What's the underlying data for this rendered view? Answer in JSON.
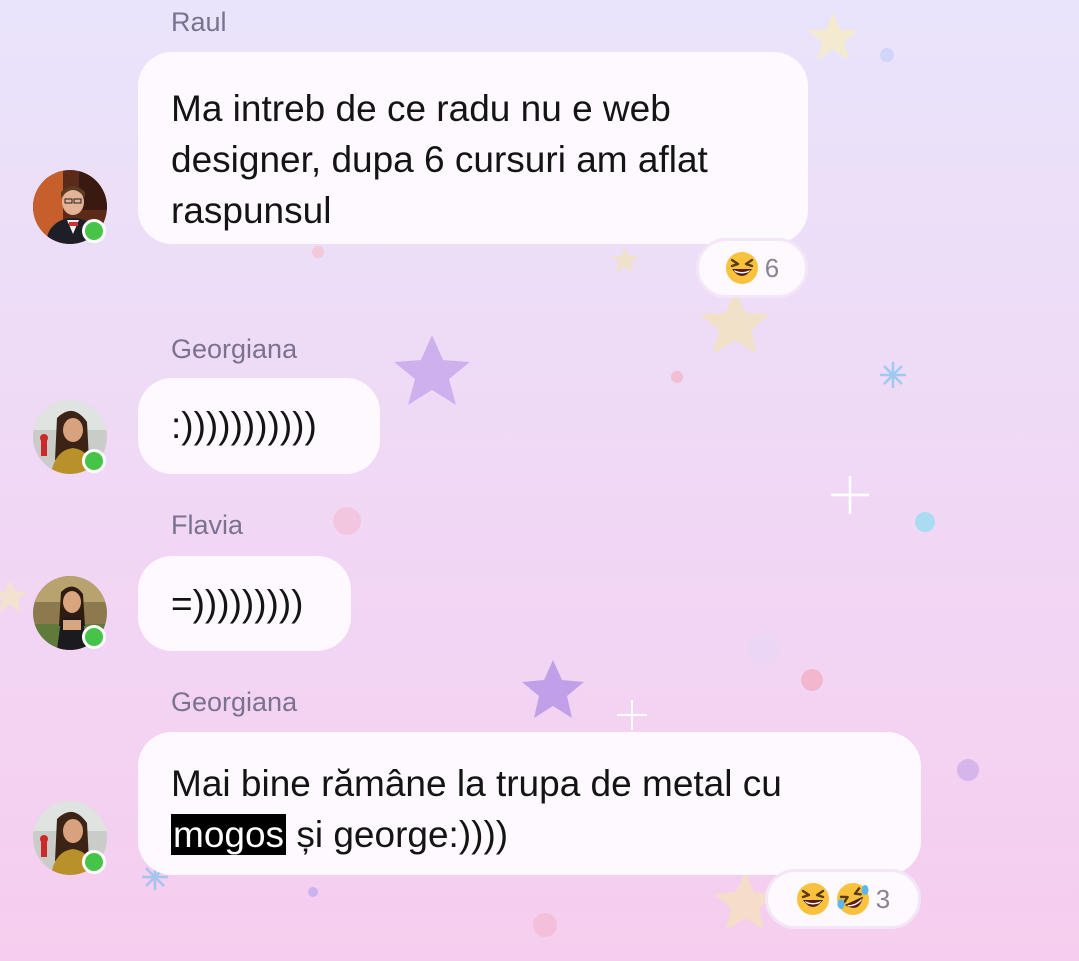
{
  "messages": [
    {
      "sender": "Raul",
      "lines": [
        "Ma intreb de ce radu nu e web",
        "designer, dupa 6 cursuri am aflat",
        "raspunsul"
      ],
      "reactions": {
        "emojis": [
          "grinning-squinting-face"
        ],
        "count": "6"
      }
    },
    {
      "sender": "Georgiana",
      "text": ":)))))))))))"
    },
    {
      "sender": "Flavia",
      "text": "=)))))))))"
    },
    {
      "sender": "Georgiana",
      "line1": "Mai bine rămâne la trupa de metal cu",
      "highlighted": "mogos",
      "line2_rest": " și george:))))",
      "reactions": {
        "emojis": [
          "grinning-squinting-face",
          "rolling-on-floor-laughing-face"
        ],
        "count": "3"
      }
    }
  ],
  "colors": {
    "bubble": "#fdf9fe",
    "sender_name": "#7b7190",
    "online": "#46c448",
    "reaction_count": "#8a8396"
  },
  "icons": [
    "online-status-icon",
    "grinning-squinting-face-icon",
    "rolling-on-floor-laughing-icon",
    "star-decoration-icon"
  ]
}
